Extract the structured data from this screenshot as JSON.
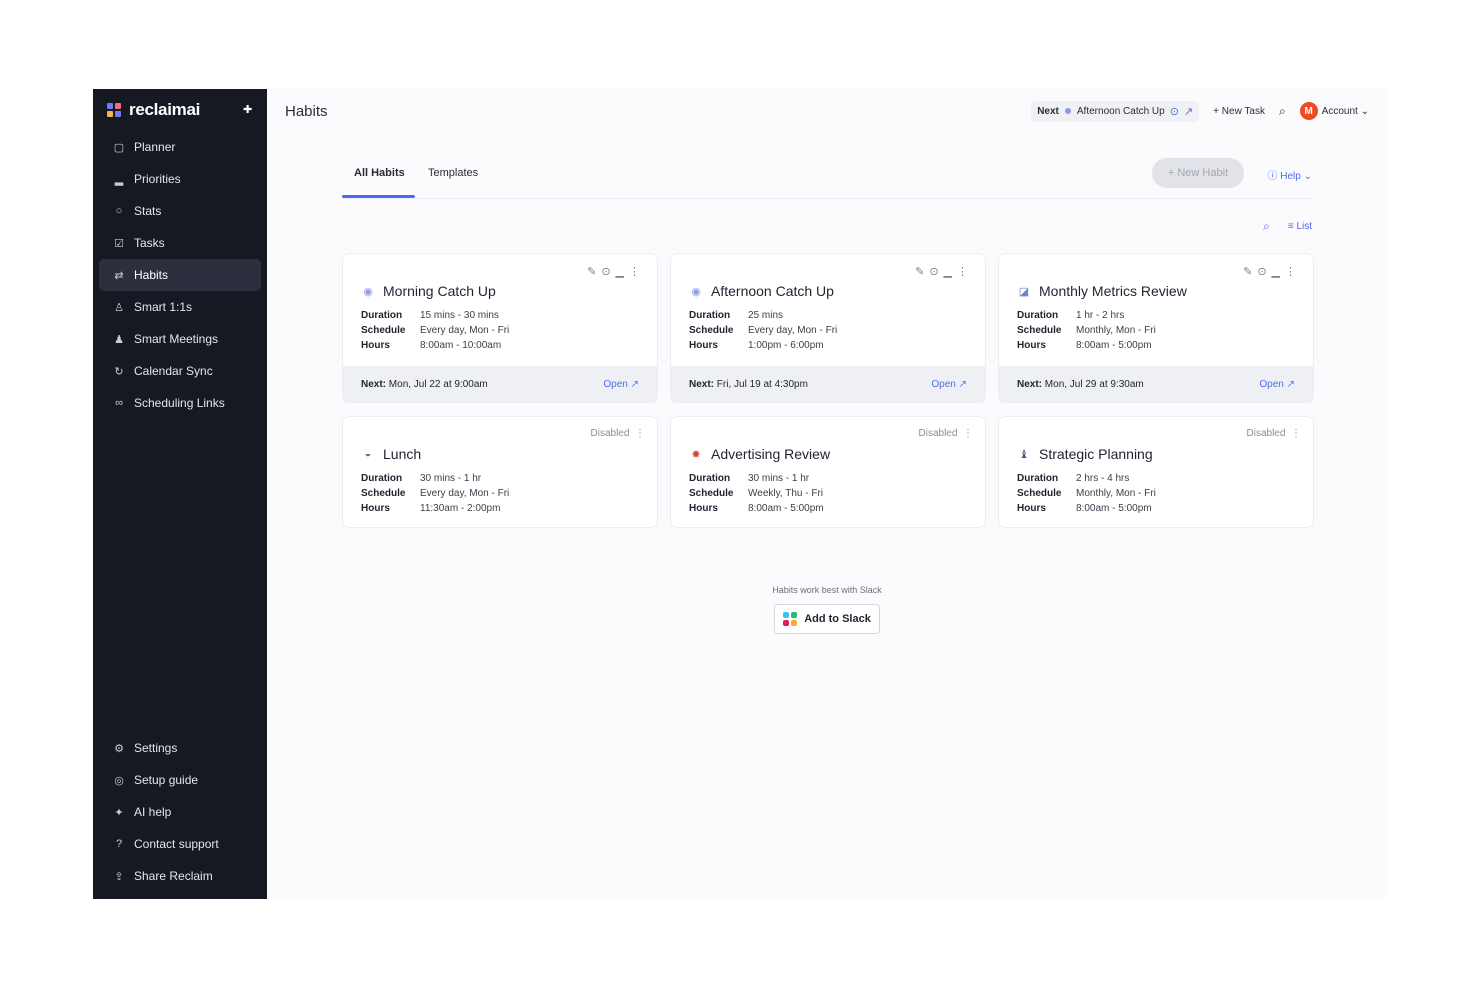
{
  "brand": {
    "name": "reclaimai"
  },
  "sidebar": {
    "items": [
      {
        "label": "Planner",
        "icon": "calendar-icon"
      },
      {
        "label": "Priorities",
        "icon": "bars-icon"
      },
      {
        "label": "Stats",
        "icon": "stats-icon"
      },
      {
        "label": "Tasks",
        "icon": "check-square-icon"
      },
      {
        "label": "Habits",
        "icon": "repeat-icon",
        "active": true
      },
      {
        "label": "Smart 1:1s",
        "icon": "people-icon"
      },
      {
        "label": "Smart Meetings",
        "icon": "group-icon"
      },
      {
        "label": "Calendar Sync",
        "icon": "sync-icon"
      },
      {
        "label": "Scheduling Links",
        "icon": "link-icon"
      }
    ],
    "bottom_items": [
      {
        "label": "Settings",
        "icon": "gear-icon"
      },
      {
        "label": "Setup guide",
        "icon": "compass-icon"
      },
      {
        "label": "AI help",
        "icon": "sparkle-icon"
      },
      {
        "label": "Contact support",
        "icon": "help-circle-icon"
      },
      {
        "label": "Share Reclaim",
        "icon": "share-icon"
      }
    ]
  },
  "header": {
    "title": "Habits",
    "next_label": "Next",
    "next_event": "Afternoon Catch Up",
    "new_task": "New Task",
    "avatar_initial": "M",
    "account": "Account"
  },
  "tabs": [
    {
      "label": "All Habits",
      "active": true
    },
    {
      "label": "Templates",
      "active": false
    }
  ],
  "toolbar": {
    "new_habit": "+ New Habit",
    "help": "Help",
    "list": "List"
  },
  "meta_labels": {
    "duration": "Duration",
    "schedule": "Schedule",
    "hours": "Hours"
  },
  "habits": [
    {
      "title": "Morning Catch Up",
      "duration": "15 mins - 30 mins",
      "schedule": "Every day, Mon - Fri",
      "hours": "8:00am - 10:00am",
      "next": "Mon, Jul 22 at 9:00am",
      "status": "active"
    },
    {
      "title": "Afternoon Catch Up",
      "duration": "25 mins",
      "schedule": "Every day, Mon - Fri",
      "hours": "1:00pm - 6:00pm",
      "next": "Fri, Jul 19 at 4:30pm",
      "status": "active"
    },
    {
      "title": "Monthly Metrics Review",
      "duration": "1 hr - 2 hrs",
      "schedule": "Monthly, Mon - Fri",
      "hours": "8:00am - 5:00pm",
      "next": "Mon, Jul 29 at 9:30am",
      "status": "active"
    },
    {
      "title": "Lunch",
      "duration": "30 mins - 1 hr",
      "schedule": "Every day, Mon - Fri",
      "hours": "11:30am - 2:00pm",
      "status": "Disabled"
    },
    {
      "title": "Advertising Review",
      "duration": "30 mins - 1 hr",
      "schedule": "Weekly, Thu - Fri",
      "hours": "8:00am - 5:00pm",
      "status": "Disabled"
    },
    {
      "title": "Strategic Planning",
      "duration": "2 hrs - 4 hrs",
      "schedule": "Monthly, Mon - Fri",
      "hours": "8:00am - 5:00pm",
      "status": "Disabled"
    }
  ],
  "card_foot": {
    "next_label": "Next:",
    "open_label": "Open"
  },
  "slack": {
    "note": "Habits work best with Slack",
    "button": "Add to Slack"
  },
  "colors": {
    "sidebar": "#171922",
    "accent": "#4f6bed",
    "avatar": "#f04a23"
  }
}
